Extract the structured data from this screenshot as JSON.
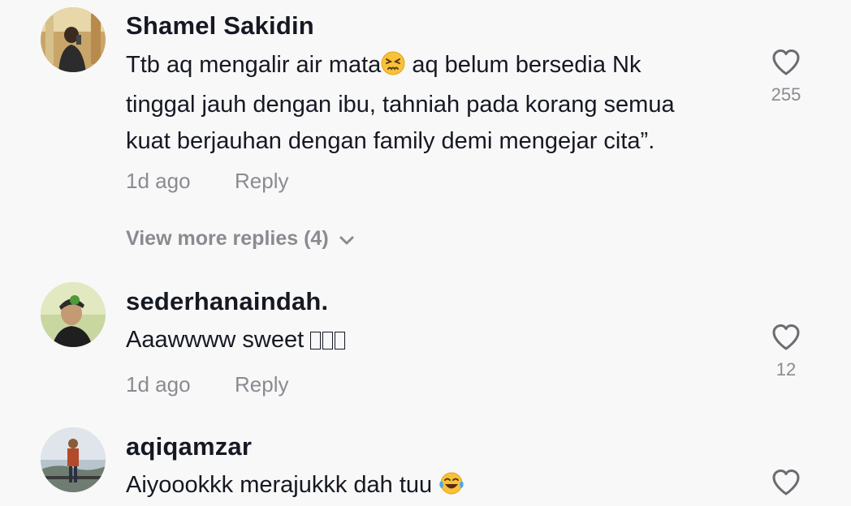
{
  "comments": [
    {
      "username": "Shamel Sakidin",
      "text_line1_a": "Ttb aq mengalir air mata",
      "text_line1_b": " aq belum bersedia Nk",
      "text_line2": "tinggal jauh dengan ibu, tahniah pada korang semua",
      "text_line3": "kuat berjauhan dengan family demi mengejar cita”.",
      "time": "1d ago",
      "reply_label": "Reply",
      "like_count": "255",
      "emoji": "persevering-face-emoji"
    },
    {
      "username": "sederhanaindah.",
      "text": "Aaawwww sweet ",
      "time": "1d ago",
      "reply_label": "Reply",
      "like_count": "12"
    },
    {
      "username": "aqiqamzar",
      "text": "Aiyoookkk merajukkk dah tuu ",
      "emoji": "tears-of-joy-emoji"
    }
  ],
  "view_more": {
    "label": "View more replies (4)"
  },
  "colors": {
    "background": "#f8f8f8",
    "primary_text": "#161823",
    "secondary_text": "#8a8b91"
  }
}
